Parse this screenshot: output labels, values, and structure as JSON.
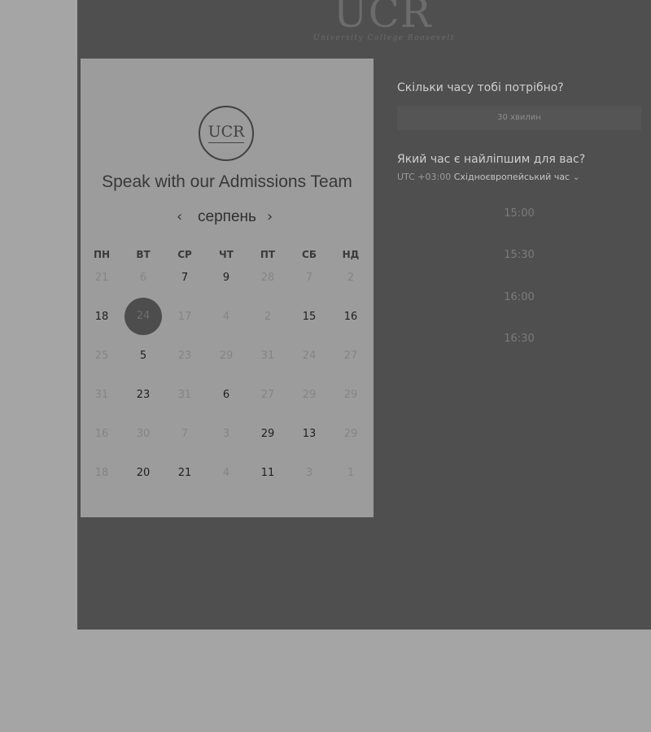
{
  "brand": {
    "logo_text": "UCR",
    "logo_subtitle": "University College Roosevelt"
  },
  "calendar": {
    "emblem_text": "UCR",
    "title": "Speak with our Admissions Team",
    "month": "серпень",
    "prev_icon": "chevron-left-icon",
    "next_icon": "chevron-right-icon",
    "weekdays": [
      "ПН",
      "ВТ",
      "СР",
      "ЧТ",
      "ПТ",
      "СБ",
      "НД"
    ],
    "rows": [
      [
        {
          "d": "21",
          "a": false
        },
        {
          "d": "6",
          "a": false
        },
        {
          "d": "7",
          "a": true
        },
        {
          "d": "9",
          "a": true
        },
        {
          "d": "28",
          "a": false
        },
        {
          "d": "7",
          "a": false
        },
        {
          "d": "2",
          "a": false
        }
      ],
      [
        {
          "d": "18",
          "a": true
        },
        {
          "d": "24",
          "a": true,
          "selected": true
        },
        {
          "d": "17",
          "a": false
        },
        {
          "d": "4",
          "a": false
        },
        {
          "d": "2",
          "a": false
        },
        {
          "d": "15",
          "a": true
        },
        {
          "d": "16",
          "a": true
        }
      ],
      [
        {
          "d": "25",
          "a": false
        },
        {
          "d": "5",
          "a": true
        },
        {
          "d": "23",
          "a": false
        },
        {
          "d": "29",
          "a": false
        },
        {
          "d": "31",
          "a": false
        },
        {
          "d": "24",
          "a": false
        },
        {
          "d": "27",
          "a": false
        }
      ],
      [
        {
          "d": "31",
          "a": false
        },
        {
          "d": "23",
          "a": true
        },
        {
          "d": "31",
          "a": false
        },
        {
          "d": "6",
          "a": true
        },
        {
          "d": "27",
          "a": false
        },
        {
          "d": "29",
          "a": false
        },
        {
          "d": "29",
          "a": false
        }
      ],
      [
        {
          "d": "16",
          "a": false
        },
        {
          "d": "30",
          "a": false
        },
        {
          "d": "7",
          "a": false
        },
        {
          "d": "3",
          "a": false
        },
        {
          "d": "29",
          "a": true
        },
        {
          "d": "13",
          "a": true
        },
        {
          "d": "29",
          "a": false
        }
      ],
      [
        {
          "d": "18",
          "a": false
        },
        {
          "d": "20",
          "a": true
        },
        {
          "d": "21",
          "a": true
        },
        {
          "d": "4",
          "a": false
        },
        {
          "d": "11",
          "a": true
        },
        {
          "d": "3",
          "a": false
        },
        {
          "d": "1",
          "a": false
        }
      ]
    ]
  },
  "booking": {
    "duration_question": "Скільки часу тобі потрібно?",
    "duration_value": "30 хвилин",
    "time_question": "Який час є найліпшим для вас?",
    "timezone_code": "UTC +03:00",
    "timezone_name": "Східноєвропейський час",
    "timezone_dropdown_icon": "chevron-down-icon",
    "slots": [
      "15:00",
      "15:30",
      "16:00",
      "16:30"
    ]
  }
}
